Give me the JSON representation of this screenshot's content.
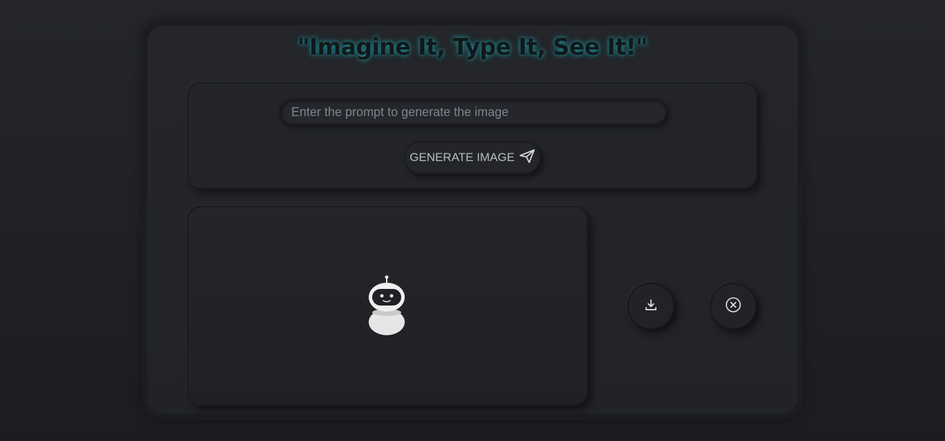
{
  "header": {
    "title": "\"Imagine It, Type It, See It!\""
  },
  "prompt": {
    "placeholder": "Enter the prompt to generate the image",
    "value": ""
  },
  "generate_button": {
    "label": "GENERATE IMAGE",
    "icon": "send-icon"
  },
  "image_area": {
    "placeholder_icon": "robot-icon"
  },
  "actions": {
    "download_icon": "download-icon",
    "clear_icon": "close-circle-icon"
  },
  "colors": {
    "title_glow": "#1d8c95",
    "background": "#222429"
  }
}
